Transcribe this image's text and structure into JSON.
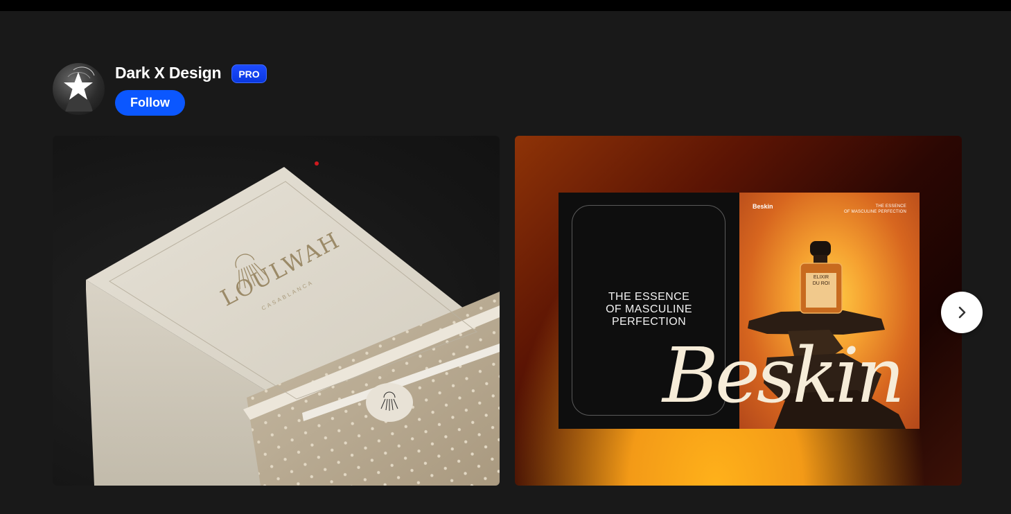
{
  "profile": {
    "name": "Dark X Design",
    "badge": "PRO",
    "follow_label": "Follow",
    "avatar_icon": "star-avatar-icon"
  },
  "projects": [
    {
      "brand": "LOULWAH",
      "subtitle": "CASABLANCA",
      "icon": "sunburst-logo-icon"
    },
    {
      "headline_lines": [
        "THE ESSENCE",
        "OF MASCULINE",
        "PERFECTION"
      ],
      "brand_small": "Beskin",
      "tagline_lines": [
        "THE ESSENCE",
        "OF MASCULINE PERFECTION"
      ],
      "product_lines": [
        "ELIXIR",
        "DU ROI"
      ],
      "brand_script": "Beskin"
    }
  ],
  "carousel": {
    "next_icon": "chevron-right-icon"
  },
  "colors": {
    "background": "#191919",
    "accent": "#0b57ff",
    "badge": "#1d4bff"
  }
}
